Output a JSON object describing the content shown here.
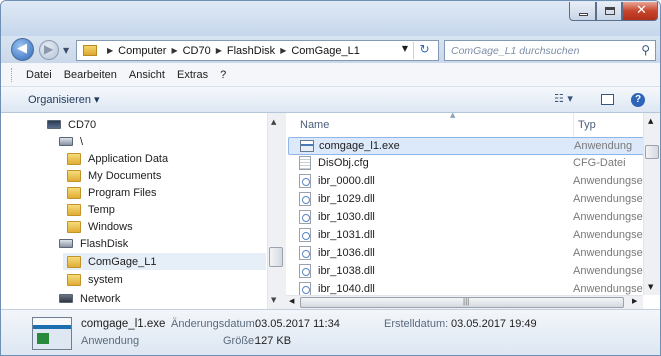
{
  "toolbar": {
    "address": [
      "Computer",
      "CD70",
      "FlashDisk",
      "ComGage_L1"
    ],
    "search_placeholder": "ComGage_L1 durchsuchen"
  },
  "menu": [
    "Datei",
    "Bearbeiten",
    "Ansicht",
    "Extras",
    "?"
  ],
  "command": {
    "organize_label": "Organisieren ▾"
  },
  "nav": {
    "items": [
      {
        "label": "CD70",
        "icon": "device-icon"
      },
      {
        "label": "\\",
        "icon": "drive-icon"
      },
      {
        "label": "Application Data",
        "icon": "folder-icon"
      },
      {
        "label": "My Documents",
        "icon": "documents-folder-icon"
      },
      {
        "label": "Program Files",
        "icon": "folder-icon"
      },
      {
        "label": "Temp",
        "icon": "folder-icon"
      },
      {
        "label": "Windows",
        "icon": "folder-icon"
      },
      {
        "label": "FlashDisk",
        "icon": "drive-icon"
      },
      {
        "label": "ComGage_L1",
        "icon": "folder-icon"
      },
      {
        "label": "system",
        "icon": "folder-icon"
      },
      {
        "label": "Network",
        "icon": "network-drive-icon"
      }
    ]
  },
  "files": {
    "columns": {
      "name": "Name",
      "type": "Typ"
    },
    "rows": [
      {
        "name": "comgage_l1.exe",
        "type": "Anwendung",
        "icon": "exe-icon"
      },
      {
        "name": "DisObj.cfg",
        "type": "CFG-Datei",
        "icon": "cfg-file-icon"
      },
      {
        "name": "ibr_0000.dll",
        "type": "Anwendungser",
        "icon": "dll-file-icon"
      },
      {
        "name": "ibr_1029.dll",
        "type": "Anwendungser",
        "icon": "dll-file-icon"
      },
      {
        "name": "ibr_1030.dll",
        "type": "Anwendungser",
        "icon": "dll-file-icon"
      },
      {
        "name": "ibr_1031.dll",
        "type": "Anwendungser",
        "icon": "dll-file-icon"
      },
      {
        "name": "ibr_1036.dll",
        "type": "Anwendungser",
        "icon": "dll-file-icon"
      },
      {
        "name": "ibr_1038.dll",
        "type": "Anwendungser",
        "icon": "dll-file-icon"
      },
      {
        "name": "ibr_1040.dll",
        "type": "Anwendungser",
        "icon": "dll-file-icon"
      }
    ]
  },
  "details": {
    "filename": "comgage_l1.exe",
    "modified_label": "Änderungsdatum:",
    "modified_value": "03.05.2017 11:34",
    "created_label": "Erstelldatum:",
    "created_value": "03.05.2017 19:49",
    "type_value": "Anwendung",
    "size_label": "Größe:",
    "size_value": "127 KB"
  },
  "colors": {
    "selection": "#dbe9fa",
    "accent": "#2d66b8"
  }
}
